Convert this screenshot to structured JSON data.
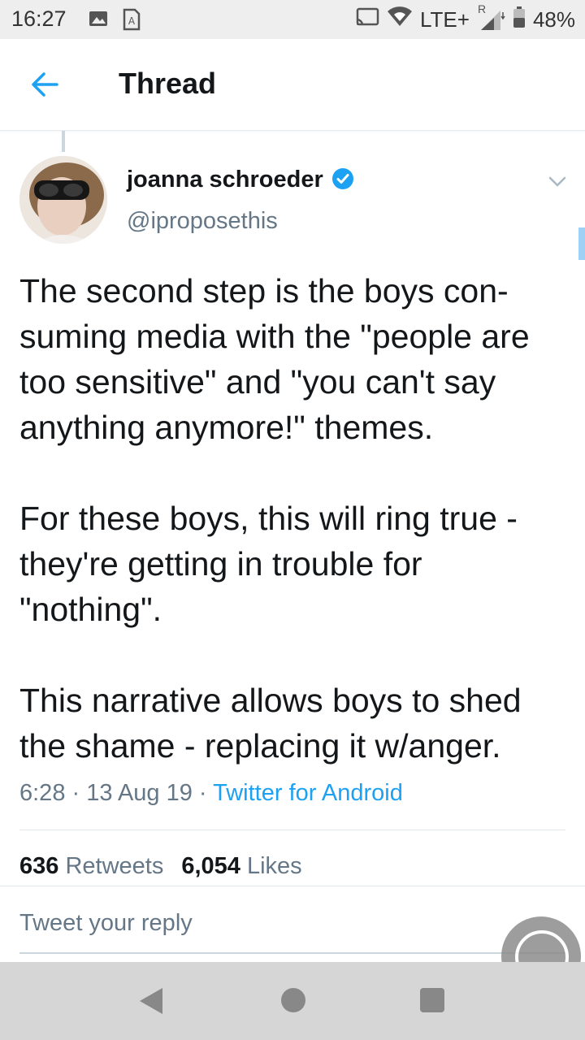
{
  "status_bar": {
    "time": "16:27",
    "network": "LTE+",
    "roaming": "R",
    "battery": "48%",
    "icons": [
      "image-icon",
      "sim-alert-icon",
      "cast-icon",
      "wifi-icon",
      "signal-icon",
      "battery-icon"
    ]
  },
  "header": {
    "title": "Thread",
    "back_icon": "arrow-left-icon"
  },
  "tweet": {
    "display_name": "joanna schroeder",
    "handle": "@iproposethis",
    "verified": true,
    "paragraphs": [
      "The second step is the boys con-suming media with the \"people are too sensitive\" and \"you can't say anything anymore!\" themes.",
      "For these boys, this will ring true - they're getting in trouble for \"nothing\".",
      "This narrative allows boys to shed the shame - replacing it w/anger."
    ],
    "time": "6:28",
    "date": "13 Aug 19",
    "source": "Twitter for Android",
    "separator": " · ",
    "retweets_count": "636",
    "retweets_label": "Retweets",
    "likes_count": "6,054",
    "likes_label": "Likes"
  },
  "reply": {
    "placeholder": "Tweet your reply"
  },
  "colors": {
    "accent": "#1da1f2",
    "text_primary": "#14171a",
    "text_secondary": "#657786",
    "divider": "#e1e8ed"
  }
}
